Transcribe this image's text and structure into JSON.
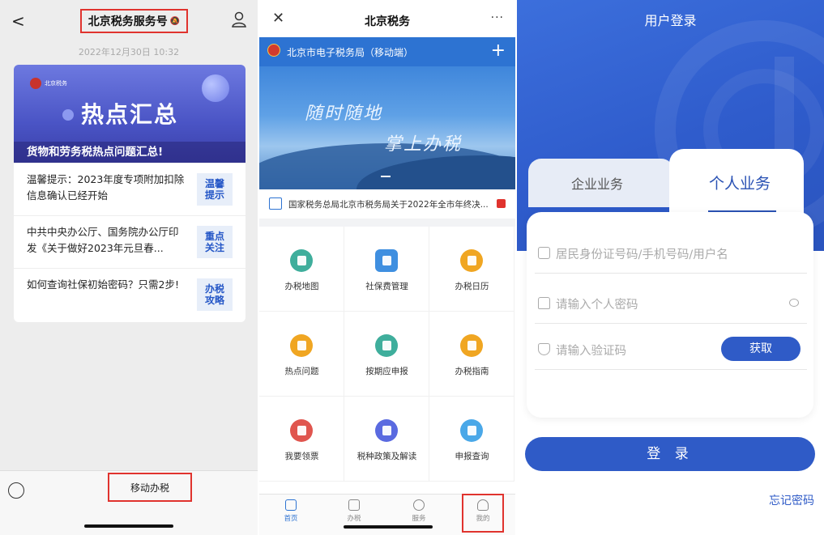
{
  "panel1": {
    "nav": {
      "back_icon": "chevron-left-icon",
      "title": "北京税务服务号",
      "mute_icon": "mute-icon",
      "user_icon": "user-icon"
    },
    "timestamp": "2022年12月30日 10:32",
    "card": {
      "logo_text": "北京税务",
      "headline": "热点汇总",
      "subtitle": "货物和劳务税热点问题汇总!",
      "items": [
        {
          "text": "温馨提示：2023年度专项附加扣除信息确认已经开始",
          "thumb": "温馨\n提示"
        },
        {
          "text": "中共中央办公厅、国务院办公厅印发《关于做好2023年元旦春...",
          "thumb": "重点\n关注"
        },
        {
          "text": "如何查询社保初始密码？只需2步!",
          "thumb": "办税\n攻略"
        }
      ]
    },
    "bottom_menu": {
      "keyboard_icon": "keyboard-icon",
      "label": "移动办税"
    }
  },
  "panel2": {
    "nav": {
      "close_icon": "close-icon",
      "title": "北京税务",
      "more_label": "···"
    },
    "header": {
      "text": "北京市电子税务局（移动端）",
      "plus": "+"
    },
    "hero": {
      "line1": "随时随地",
      "line2": "掌上办税"
    },
    "notice": {
      "text": "国家税务总局北京市税务局关于2022年全市年终决..."
    },
    "grid": [
      {
        "label": "办税地图",
        "color": "#3fae9c",
        "icon": "map-icon"
      },
      {
        "label": "社保费管理",
        "color": "#3f8fe0",
        "icon": "wallet-icon"
      },
      {
        "label": "办税日历",
        "color": "#f0a622",
        "icon": "calendar-icon"
      },
      {
        "label": "热点问题",
        "color": "#f0a622",
        "icon": "document-icon"
      },
      {
        "label": "按期应申报",
        "color": "#3fae9c",
        "icon": "edit-icon"
      },
      {
        "label": "办税指南",
        "color": "#f0a622",
        "icon": "guide-icon"
      },
      {
        "label": "我要领票",
        "color": "#e0554e",
        "icon": "ticket-icon"
      },
      {
        "label": "税种政策及解读",
        "color": "#5a6ae0",
        "icon": "policy-icon"
      },
      {
        "label": "申报查询",
        "color": "#4aa8e8",
        "icon": "query-icon"
      }
    ],
    "tabbar": [
      {
        "label": "首页",
        "icon": "home-icon"
      },
      {
        "label": "办税",
        "icon": "list-icon"
      },
      {
        "label": "服务",
        "icon": "heart-icon"
      },
      {
        "label": "我的",
        "icon": "user-icon"
      }
    ]
  },
  "panel3": {
    "title": "用户登录",
    "tabs": {
      "left": "企业业务",
      "right": "个人业务"
    },
    "fields": {
      "id_placeholder": "居民身份证号码/手机号码/用户名",
      "password_placeholder": "请输入个人密码",
      "captcha_placeholder": "请输入验证码"
    },
    "get_code_label": "获取",
    "login_label": "登 录",
    "forgot_label": "忘记密码"
  }
}
